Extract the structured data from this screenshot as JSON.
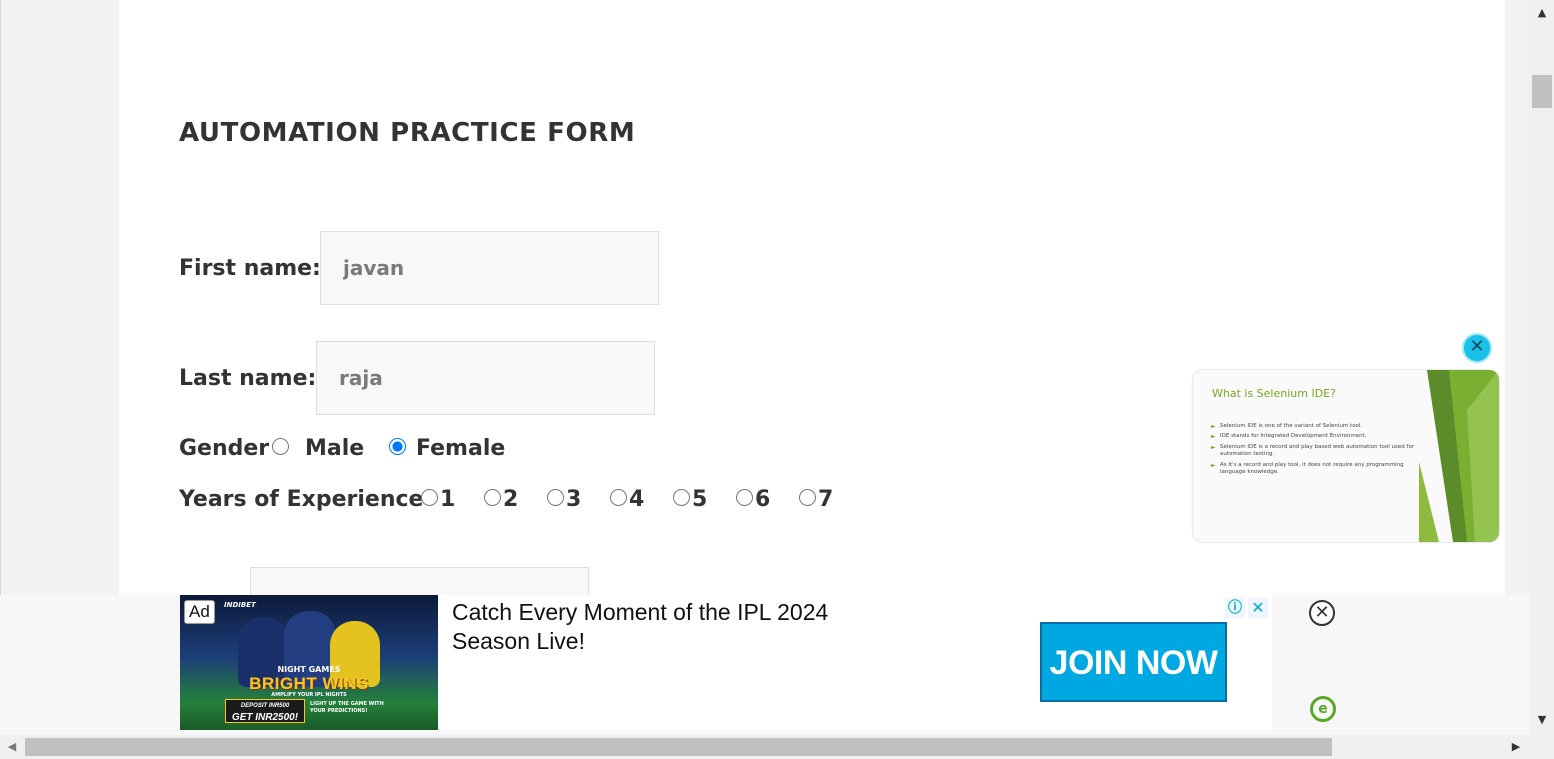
{
  "form": {
    "title": "AUTOMATION PRACTICE FORM",
    "first_name": {
      "label": "First name:",
      "value": "javan"
    },
    "last_name": {
      "label": "Last name:",
      "value": "raja"
    },
    "gender": {
      "label": "Gender",
      "options": [
        "Male",
        "Female"
      ],
      "selected": "Female"
    },
    "experience": {
      "label": "Years of Experience",
      "options": [
        "1",
        "2",
        "3",
        "4",
        "5",
        "6",
        "7"
      ],
      "selected": null
    }
  },
  "video_ad": {
    "slide_title": "What is Selenium IDE?",
    "bullets": [
      "Selenium IDE is one of the variant of Selenium tool.",
      "IDE stands for Integrated Development Environment.",
      "Selenium IDE is a record and play based web automation tool used for automation testing.",
      "As it's a record and play tool, it does not require any programming language knowledge."
    ],
    "close_icon": "close-icon"
  },
  "banner_ad": {
    "badge": "Ad",
    "brand": "INDIBET",
    "image_text": {
      "night_games": "NIGHT GAMES",
      "bright_wins": "BRIGHT WINS",
      "amplify": "AMPLIFY YOUR IPL NIGHTS",
      "deposit_line1": "DEPOSIT INR500",
      "deposit_line2": "GET INR2500!",
      "light_up": "LIGHT UP THE GAME WITH YOUR PREDICTIONS!"
    },
    "headline": "Catch Every Moment of the IPL 2024 Season Live!",
    "cta": "JOIN NOW",
    "info_icon": "info-icon",
    "close_icon": "close-icon",
    "colors": {
      "cta": "#00a8e1",
      "accent": "#5ba829"
    }
  }
}
